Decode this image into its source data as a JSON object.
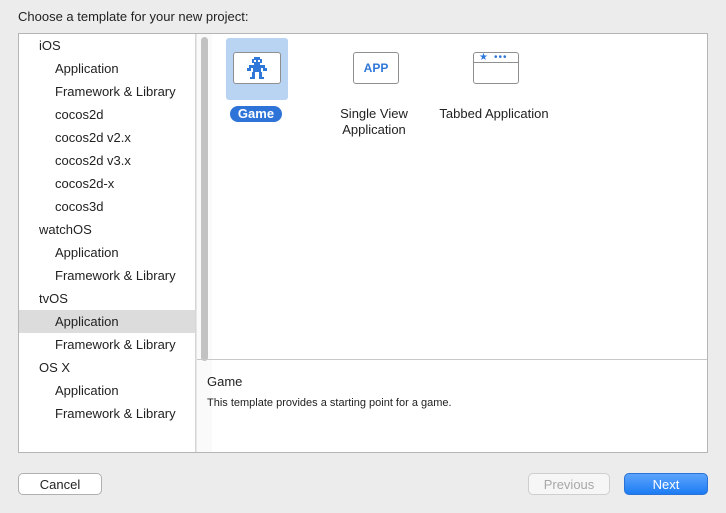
{
  "dialog": {
    "heading": "Choose a template for your new project:"
  },
  "sidebar": {
    "groups": [
      {
        "label": "iOS",
        "items": [
          "Application",
          "Framework & Library",
          "cocos2d",
          "cocos2d v2.x",
          "cocos2d v3.x",
          "cocos2d-x",
          "cocos3d"
        ]
      },
      {
        "label": "watchOS",
        "items": [
          "Application",
          "Framework & Library"
        ]
      },
      {
        "label": "tvOS",
        "items": [
          "Application",
          "Framework & Library"
        ]
      },
      {
        "label": "OS X",
        "items": [
          "Application",
          "Framework & Library"
        ]
      }
    ],
    "selected": "tvOS / Application"
  },
  "templates": [
    {
      "label": "Game",
      "icon": "game-icon",
      "selected": true
    },
    {
      "label": "Single View Application",
      "icon": "app-icon",
      "glyph": "APP",
      "selected": false
    },
    {
      "label": "Tabbed Application",
      "icon": "tabbed-icon",
      "selected": false
    }
  ],
  "detail": {
    "title": "Game",
    "description": "This template provides a starting point for a game."
  },
  "buttons": {
    "cancel": "Cancel",
    "previous": "Previous",
    "next": "Next"
  },
  "colors": {
    "accent": "#2e74d8",
    "selection_tile": "#b8d4f2",
    "sidebar_selection": "#dcdcdc"
  }
}
